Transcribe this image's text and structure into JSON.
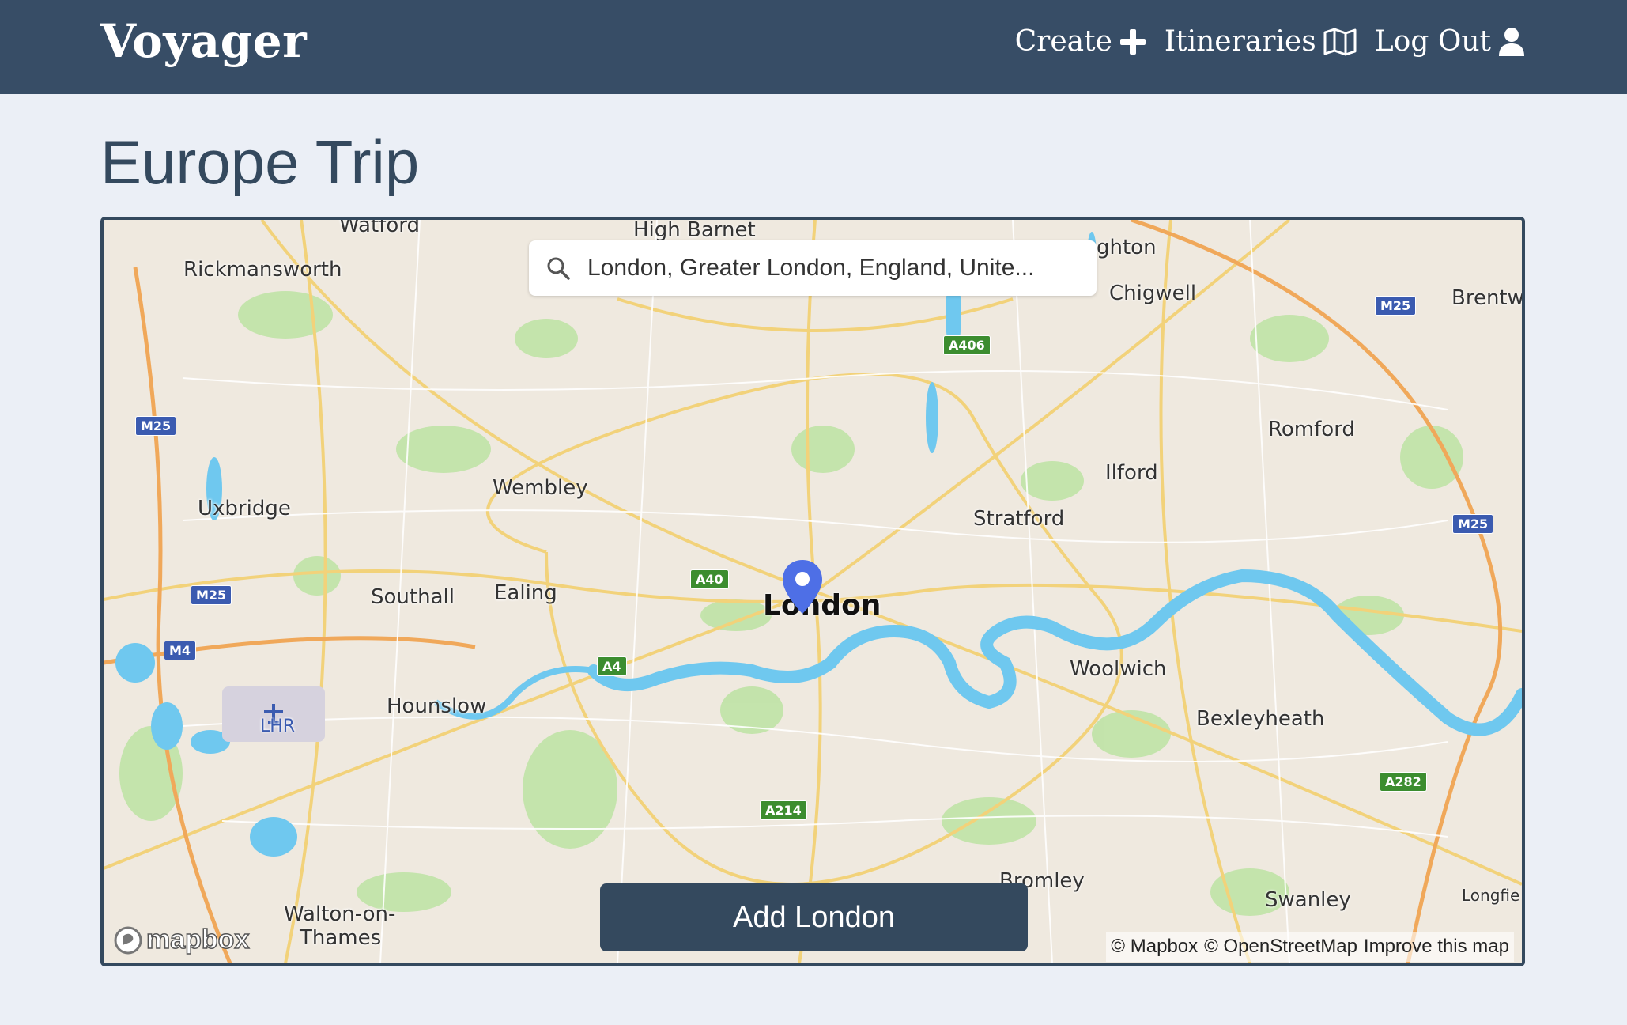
{
  "nav": {
    "brand": "Voyager",
    "links": [
      {
        "label": "Create",
        "icon": "plus-icon"
      },
      {
        "label": "Itineraries",
        "icon": "map-icon"
      },
      {
        "label": "Log Out",
        "icon": "user-icon"
      }
    ]
  },
  "page": {
    "title": "Europe Trip"
  },
  "map": {
    "search_value": "London, Greater London, England, Unite...",
    "add_button": "Add London",
    "logo_text": "mapbox",
    "attribution": {
      "mapbox": "© Mapbox",
      "osm": "© OpenStreetMap",
      "improve": "Improve this map"
    },
    "places": {
      "watford": "Watford",
      "high_barnet": "High Barnet",
      "loughton": "ghton",
      "rickmansworth": "Rickmansworth",
      "chigwell": "Chigwell",
      "brentwood": "Brentw",
      "romford": "Romford",
      "ilford": "Ilford",
      "wembley": "Wembley",
      "uxbridge": "Uxbridge",
      "stratford": "Stratford",
      "southall": "Southall",
      "ealing": "Ealing",
      "london": "London",
      "woolwich": "Woolwich",
      "hounslow": "Hounslow",
      "lhr": "LHR",
      "bexleyheath": "Bexleyheath",
      "bromley": "Bromley",
      "swanley": "Swanley",
      "longfield": "Longfie",
      "walton": "Walton-on-",
      "thames": "Thames"
    },
    "roads": {
      "m25_a": "M25",
      "m25_b": "M25",
      "m25_c": "M25",
      "m25_d": "M25",
      "m4": "M4",
      "a406": "A406",
      "a40": "A40",
      "a4": "A4",
      "a214": "A214",
      "a282": "A282"
    }
  }
}
